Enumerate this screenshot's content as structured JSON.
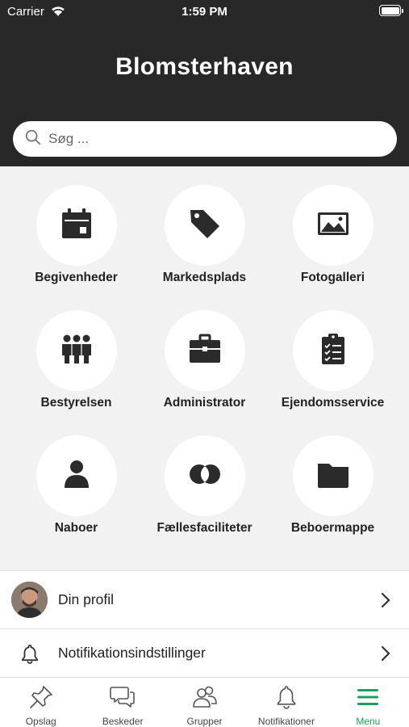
{
  "status_bar": {
    "carrier": "Carrier",
    "time": "1:59 PM"
  },
  "header": {
    "title": "Blomsterhaven"
  },
  "search": {
    "placeholder": "Søg ..."
  },
  "tiles": [
    {
      "label": "Begivenheder",
      "icon": "calendar-icon"
    },
    {
      "label": "Markedsplads",
      "icon": "price-tag-icon"
    },
    {
      "label": "Fotogalleri",
      "icon": "image-icon"
    },
    {
      "label": "Bestyrelsen",
      "icon": "people-group-icon"
    },
    {
      "label": "Administrator",
      "icon": "briefcase-icon"
    },
    {
      "label": "Ejendomsservice",
      "icon": "clipboard-checklist-icon"
    },
    {
      "label": "Naboer",
      "icon": "person-icon"
    },
    {
      "label": "Fællesfaciliteter",
      "icon": "overlapping-circles-icon"
    },
    {
      "label": "Beboermappe",
      "icon": "folder-icon"
    }
  ],
  "list": {
    "profile_label": "Din profil",
    "notifications_label": "Notifikationsindstillinger"
  },
  "tabbar": {
    "items": [
      {
        "label": "Opslag",
        "icon": "pin-icon"
      },
      {
        "label": "Beskeder",
        "icon": "chat-bubbles-icon"
      },
      {
        "label": "Grupper",
        "icon": "group-icon"
      },
      {
        "label": "Notifikationer",
        "icon": "bell-icon"
      },
      {
        "label": "Menu",
        "icon": "menu-icon"
      }
    ],
    "active_index": 4
  },
  "colors": {
    "header_bg": "#282828",
    "accent": "#1e9d5c",
    "icon_dark": "#2b2b2b"
  }
}
